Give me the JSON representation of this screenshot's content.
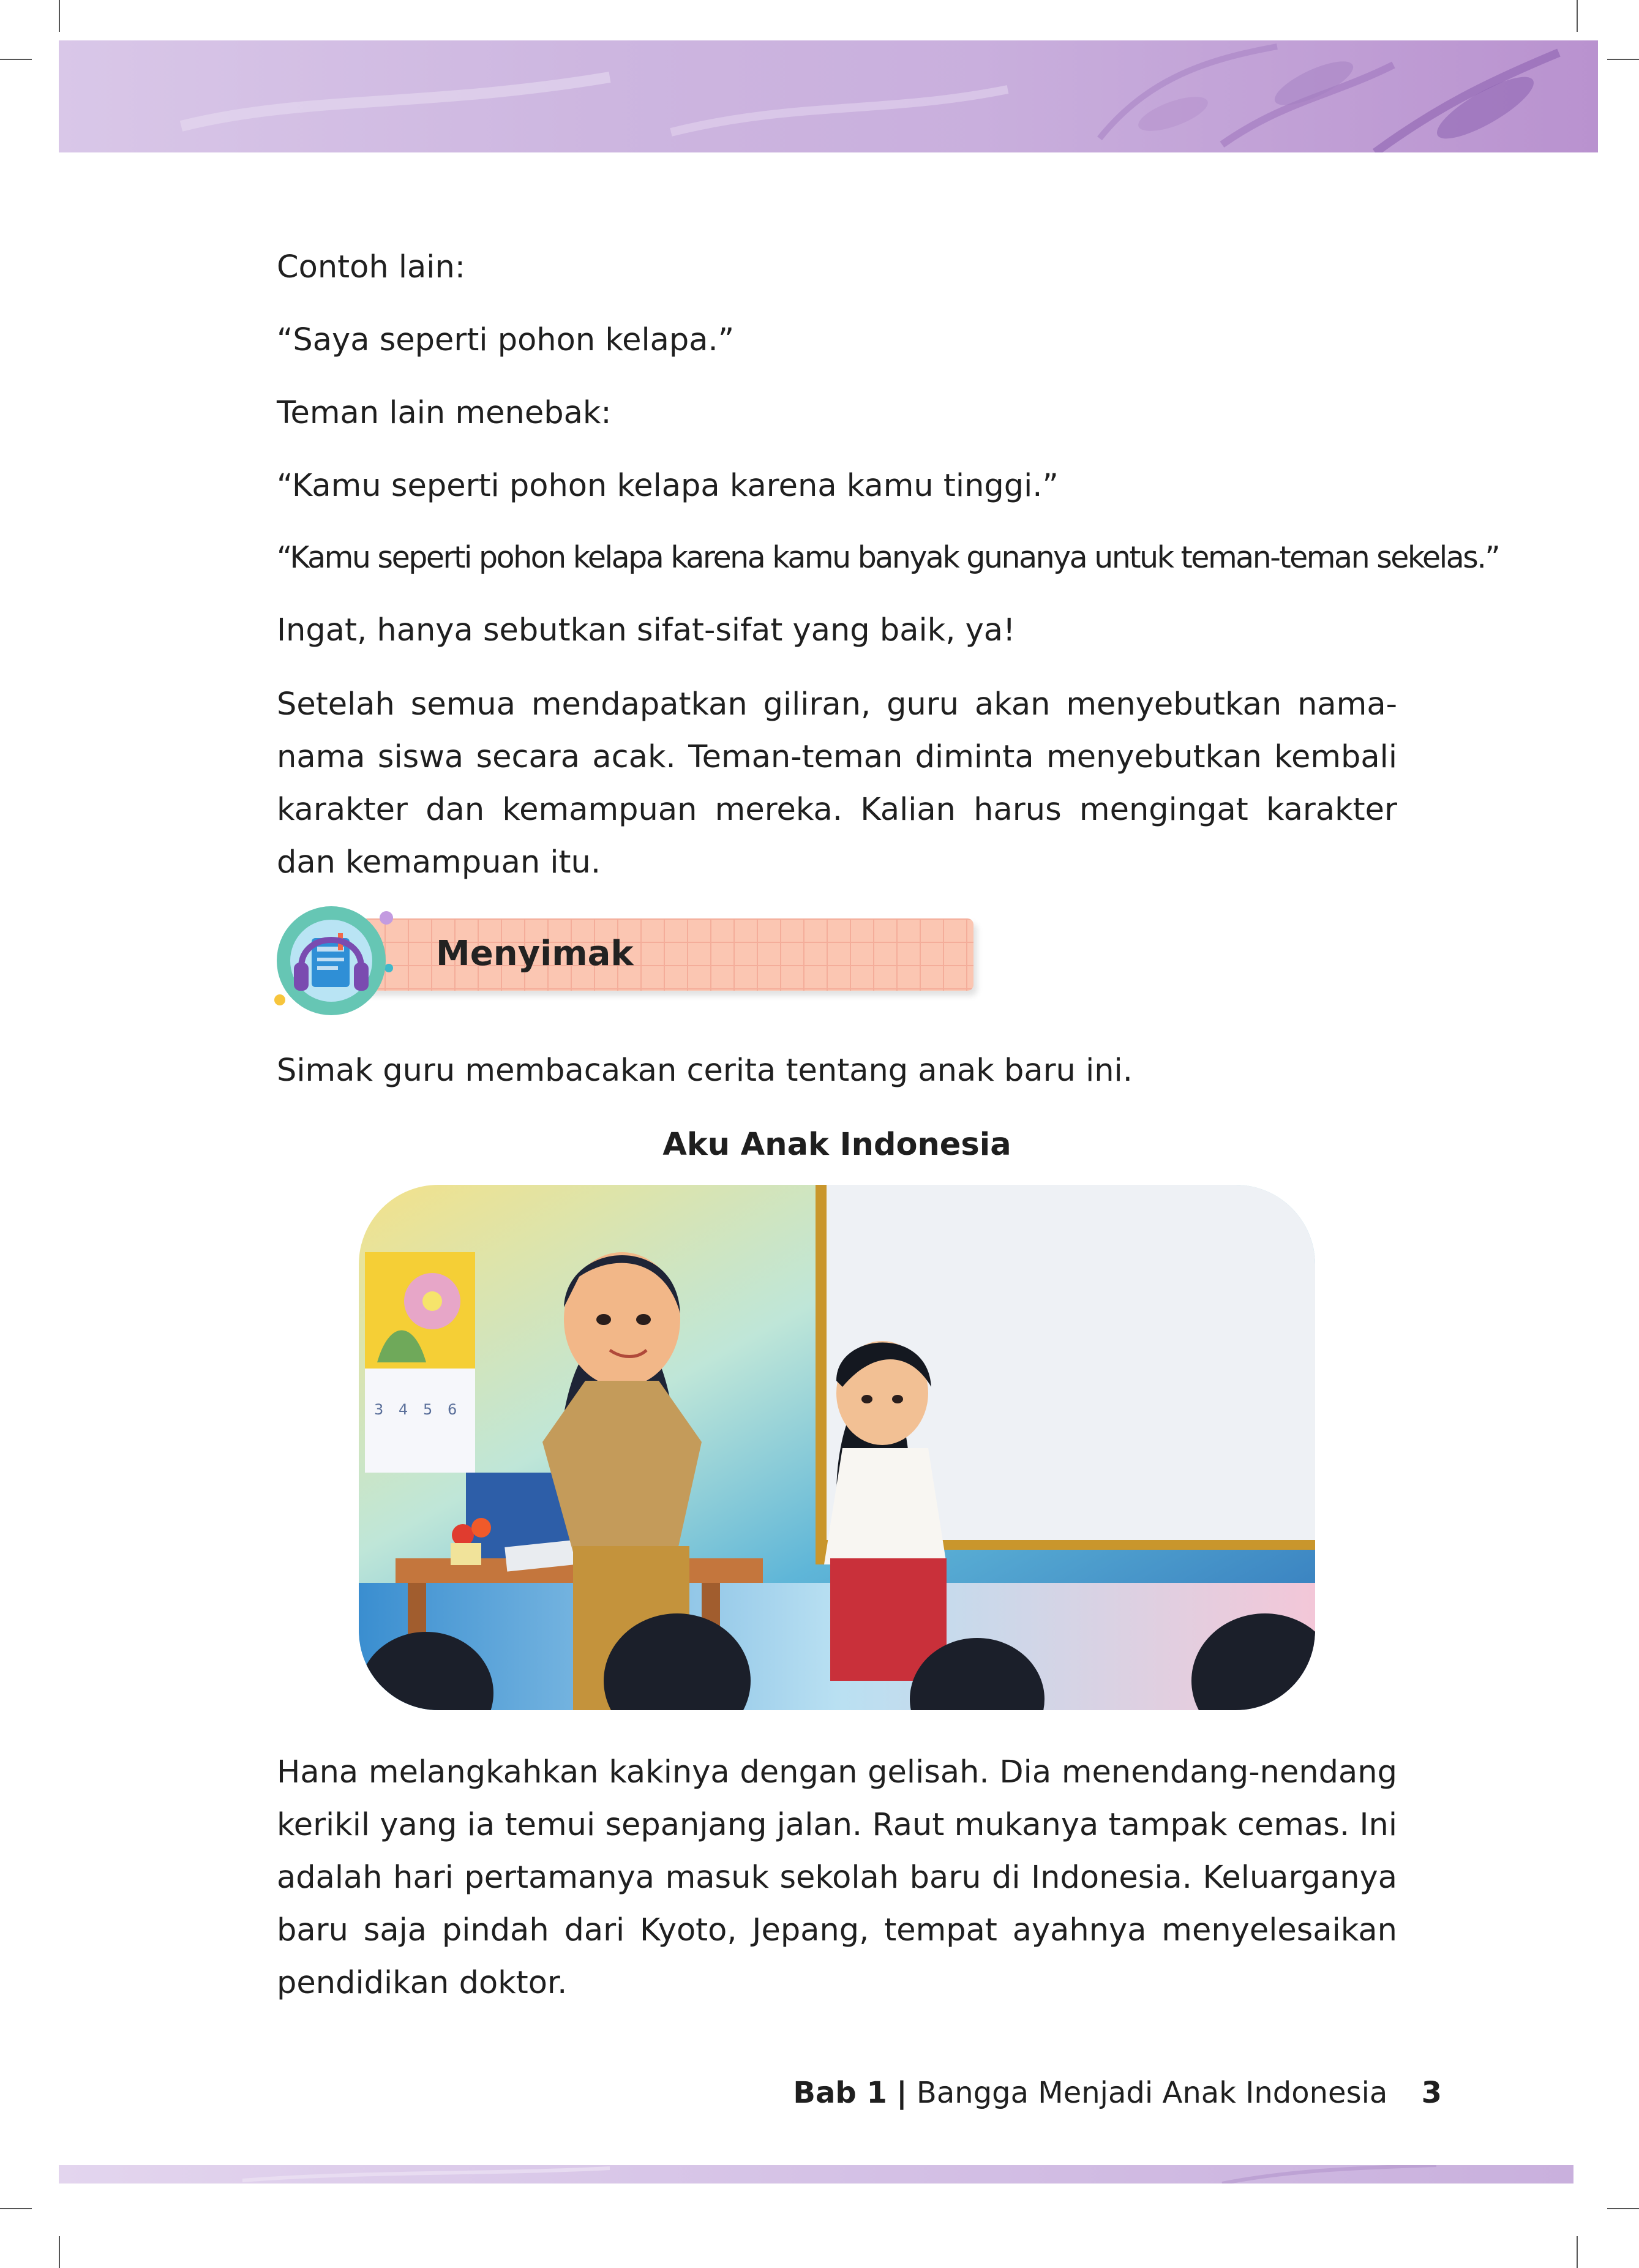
{
  "paragraphs_top": [
    "Contoh lain:",
    "“Saya seperti pohon kelapa.”",
    "Teman lain menebak:",
    "“Kamu seperti pohon kelapa karena kamu tinggi.”",
    "“Kamu seperti pohon kelapa karena kamu banyak gunanya untuk teman-teman sekelas.”",
    "Ingat, hanya sebutkan sifat-sifat yang baik, ya!",
    "Setelah semua mendapatkan giliran, guru akan menyebutkan nama-nama siswa secara acak. Teman-teman diminta menyebutkan kembali karakter dan kemampuan mereka. Kalian harus mengingat karakter dan kemampuan itu."
  ],
  "section": {
    "title": "Menyimak",
    "icon": "headphones-book-icon"
  },
  "instruction": "Simak guru membacakan cerita tentang anak baru ini.",
  "story": {
    "title": "Aku Anak Indonesia",
    "paragraph": "Hana melangkahkan kakinya dengan gelisah. Dia menendang-nendang kerikil yang ia temui sepanjang jalan. Raut mukanya tampak cemas. Ini adalah hari pertamanya masuk sekolah baru di Indonesia. Keluarganya baru saja pindah dari Kyoto, Jepang, tempat ayahnya menyelesaikan pendidikan doktor."
  },
  "illustration": {
    "calendar_numbers": [
      "3",
      "4",
      "5",
      "6"
    ]
  },
  "footer": {
    "chapter": "Bab 1",
    "separator": "|",
    "chapter_title": "Bangga Menjadi Anak Indonesia",
    "page_number": "3"
  },
  "colors": {
    "header_band": "#c9afdd",
    "section_bar": "#fbc6b2",
    "badge": "#66c6b4"
  }
}
